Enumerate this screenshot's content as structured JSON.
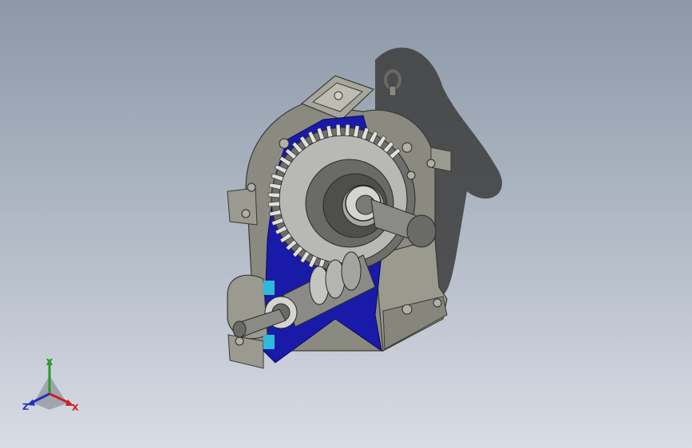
{
  "viewport": {
    "background_top": "#8c98a8",
    "background_bottom": "#d8dce4"
  },
  "model": {
    "housing_color": "#8a8a80",
    "section_color": "#1a1aa8",
    "gear_color": "#b8b8b4",
    "cyan_color": "#30b8d8"
  },
  "triad": {
    "x_label": "X",
    "y_label": "Y",
    "z_label": "Z",
    "x_color": "#d02020",
    "y_color": "#2a9a2a",
    "z_color": "#2030c0"
  }
}
